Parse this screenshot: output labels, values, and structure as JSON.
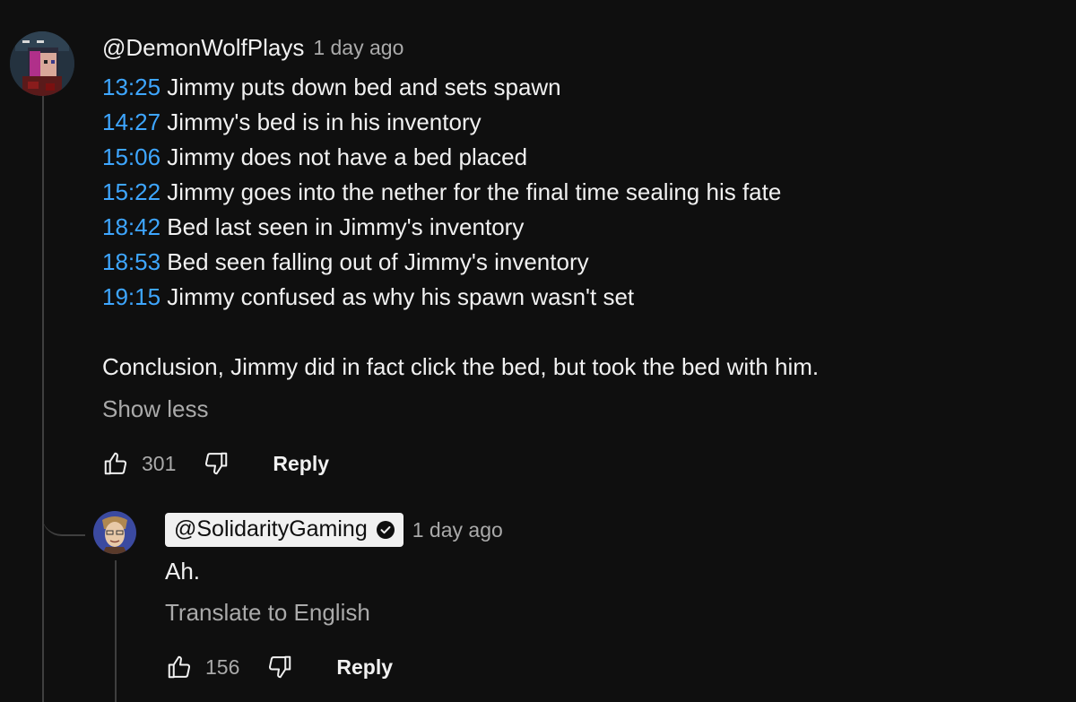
{
  "colors": {
    "background": "#0f0f0f",
    "text": "#f1f1f1",
    "muted": "#aaaaaa",
    "timestamp_link": "#3ea6ff",
    "thread_line": "#3f3f3f"
  },
  "comment": {
    "author": "@DemonWolfPlays",
    "time_ago": "1 day ago",
    "avatar_icon": "pixel-character-avatar",
    "lines": [
      {
        "ts": "13:25",
        "text": " Jimmy puts down bed and sets spawn"
      },
      {
        "ts": "14:27",
        "text": " Jimmy's bed is in his inventory"
      },
      {
        "ts": "15:06",
        "text": " Jimmy does not have a bed placed"
      },
      {
        "ts": "15:22",
        "text": " Jimmy goes into the nether for the final time sealing his fate"
      },
      {
        "ts": "18:42",
        "text": " Bed last seen in Jimmy's inventory"
      },
      {
        "ts": "18:53",
        "text": " Bed seen falling out of Jimmy's inventory"
      },
      {
        "ts": "19:15",
        "text": " Jimmy confused as why his spawn wasn't set"
      }
    ],
    "conclusion": "Conclusion, Jimmy did in fact click the bed, but took the bed with him.",
    "show_less_label": "Show less",
    "likes": "301",
    "reply_label": "Reply"
  },
  "reply": {
    "author": "@SolidarityGaming",
    "verified_icon": "verified-check-icon",
    "time_ago": "1 day ago",
    "avatar_icon": "cartoon-character-avatar",
    "text": "Ah.",
    "translate_label": "Translate to English",
    "likes": "156",
    "reply_label": "Reply"
  }
}
